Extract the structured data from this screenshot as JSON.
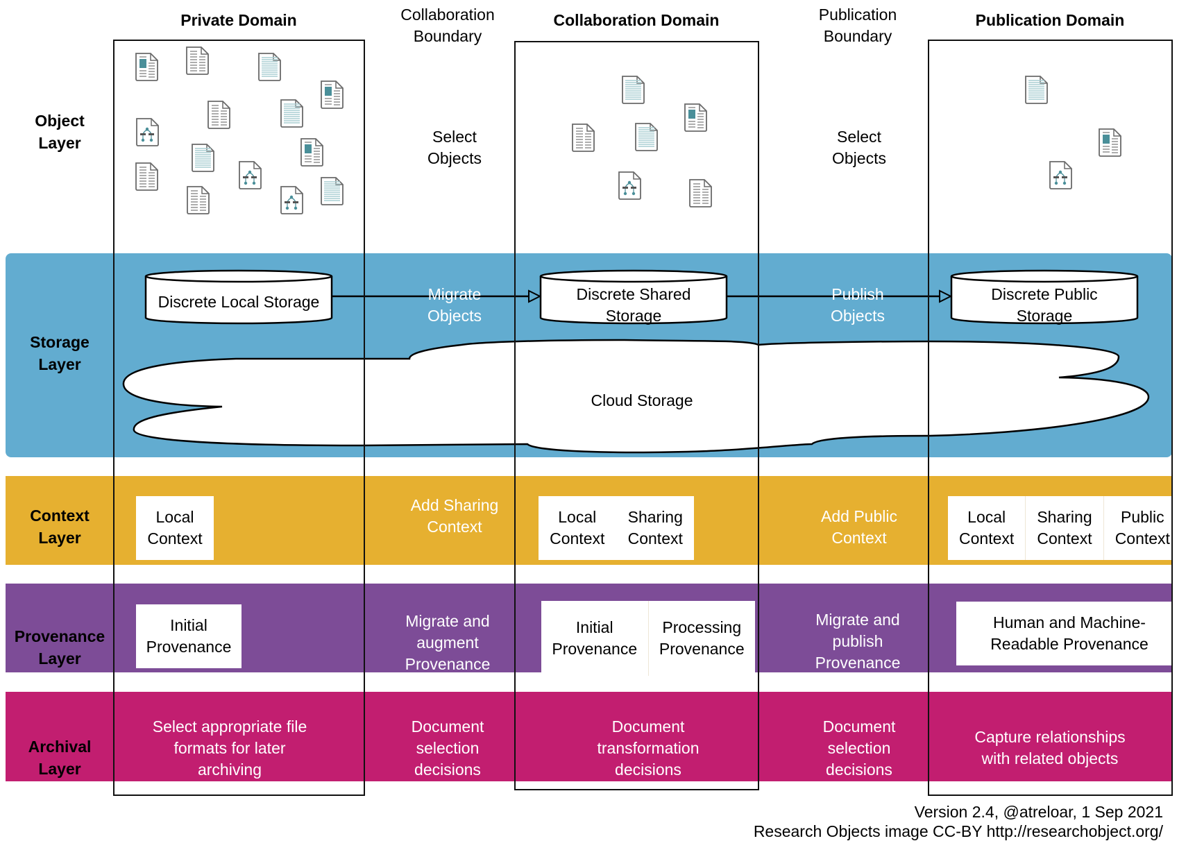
{
  "colors": {
    "storage": "#62acd0",
    "context": "#e6b030",
    "provenance": "#7d4c97",
    "archival": "#c21e70",
    "icon_stroke": "#6a6a6a",
    "icon_accent": "#4a8f99"
  },
  "domains": [
    {
      "id": "private",
      "title": "Private Domain"
    },
    {
      "id": "collaboration",
      "title": "Collaboration Domain"
    },
    {
      "id": "publication",
      "title": "Publication Domain"
    }
  ],
  "boundaries": [
    {
      "id": "collaboration-boundary",
      "title": "Collaboration\nBoundary"
    },
    {
      "id": "publication-boundary",
      "title": "Publication\nBoundary"
    }
  ],
  "layers": {
    "object": {
      "label": "Object\nLayer",
      "transitions": [
        "Select\nObjects",
        "Select\nObjects"
      ],
      "objects": {
        "private": [
          "image-doc",
          "text-doc",
          "data-doc",
          "image-doc",
          "text-doc",
          "data-doc",
          "workflow-doc",
          "data-doc",
          "image-doc",
          "text-doc",
          "workflow-doc",
          "text-doc",
          "workflow-doc",
          "data-doc"
        ],
        "collaboration": [
          "data-doc",
          "image-doc",
          "text-doc",
          "data-doc",
          "workflow-doc",
          "text-doc"
        ],
        "publication": [
          "data-doc",
          "image-doc",
          "workflow-doc"
        ]
      }
    },
    "storage": {
      "label": "Storage\nLayer",
      "stores": [
        "Discrete Local Storage",
        "Discrete Shared\nStorage",
        "Discrete Public\nStorage"
      ],
      "transitions": [
        "Migrate\nObjects",
        "Publish\nObjects"
      ],
      "cloud": "Cloud Storage"
    },
    "context": {
      "label": "Context\nLayer",
      "private": [
        "Local\nContext"
      ],
      "transition1": "Add Sharing\nContext",
      "collaboration": [
        "Local\nContext",
        "Sharing\nContext"
      ],
      "transition2": "Add Public\nContext",
      "publication": [
        "Local\nContext",
        "Sharing\nContext",
        "Public\nContext"
      ]
    },
    "provenance": {
      "label": "Provenance\nLayer",
      "private": [
        "Initial\nProvenance"
      ],
      "transition1": "Migrate and\naugment\nProvenance",
      "collaboration": [
        "Initial\nProvenance",
        "Processing\nProvenance"
      ],
      "transition2": "Migrate and\npublish\nProvenance",
      "publication": [
        "Human and Machine-\nReadable  Provenance"
      ]
    },
    "archival": {
      "label": "Archival\nLayer",
      "private": "Select appropriate file\nformats for later\narchiving",
      "transition1": "Document\nselection\ndecisions",
      "collaboration": "Document\ntransformation\ndecisions",
      "transition2": "Document\nselection\ndecisions",
      "publication": "Capture relationships\nwith related objects"
    }
  },
  "footer": {
    "line1": "Version 2.4, @atreloar, 1 Sep 2021",
    "line2": "Research Objects image CC-BY  http://researchobject.org/"
  }
}
